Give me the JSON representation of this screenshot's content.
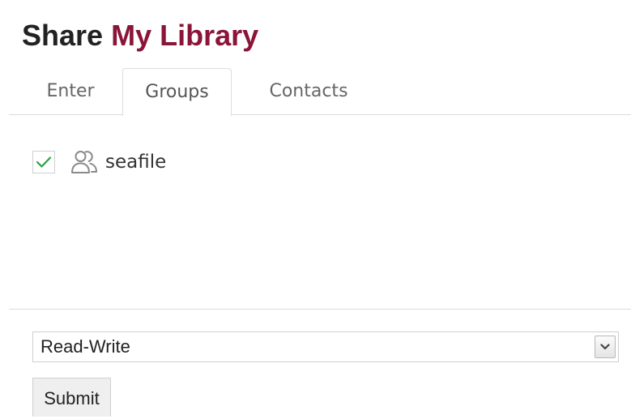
{
  "dialog": {
    "title_prefix": "Share",
    "title_library": "My Library",
    "accent_color": "#8a1538"
  },
  "tabs": [
    {
      "label": "Enter",
      "active": false
    },
    {
      "label": "Groups",
      "active": true
    },
    {
      "label": "Contacts",
      "active": false
    }
  ],
  "groups": [
    {
      "name": "seafile",
      "checked": true,
      "icon": "group-icon"
    }
  ],
  "permission": {
    "selected": "Read-Write",
    "icon": "chevron-down-icon"
  },
  "submit_label": "Submit",
  "colors": {
    "check": "#2ea043",
    "border": "#dcdcdc"
  }
}
